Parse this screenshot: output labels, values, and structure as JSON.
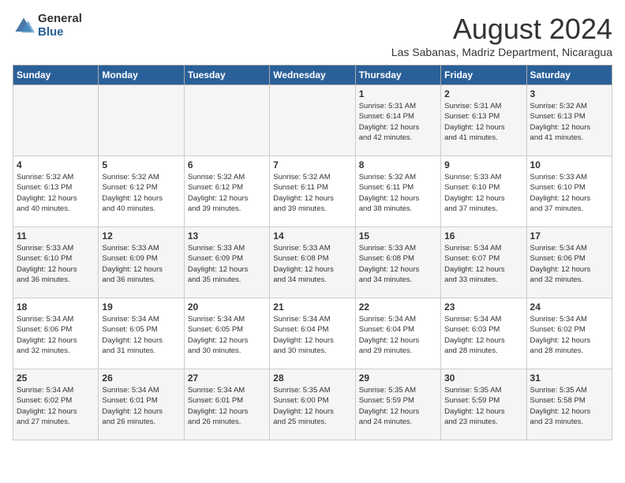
{
  "logo": {
    "general": "General",
    "blue": "Blue"
  },
  "title": {
    "month_year": "August 2024",
    "location": "Las Sabanas, Madriz Department, Nicaragua"
  },
  "days_of_week": [
    "Sunday",
    "Monday",
    "Tuesday",
    "Wednesday",
    "Thursday",
    "Friday",
    "Saturday"
  ],
  "weeks": [
    [
      {
        "day": "",
        "info": ""
      },
      {
        "day": "",
        "info": ""
      },
      {
        "day": "",
        "info": ""
      },
      {
        "day": "",
        "info": ""
      },
      {
        "day": "1",
        "info": "Sunrise: 5:31 AM\nSunset: 6:14 PM\nDaylight: 12 hours\nand 42 minutes."
      },
      {
        "day": "2",
        "info": "Sunrise: 5:31 AM\nSunset: 6:13 PM\nDaylight: 12 hours\nand 41 minutes."
      },
      {
        "day": "3",
        "info": "Sunrise: 5:32 AM\nSunset: 6:13 PM\nDaylight: 12 hours\nand 41 minutes."
      }
    ],
    [
      {
        "day": "4",
        "info": "Sunrise: 5:32 AM\nSunset: 6:13 PM\nDaylight: 12 hours\nand 40 minutes."
      },
      {
        "day": "5",
        "info": "Sunrise: 5:32 AM\nSunset: 6:12 PM\nDaylight: 12 hours\nand 40 minutes."
      },
      {
        "day": "6",
        "info": "Sunrise: 5:32 AM\nSunset: 6:12 PM\nDaylight: 12 hours\nand 39 minutes."
      },
      {
        "day": "7",
        "info": "Sunrise: 5:32 AM\nSunset: 6:11 PM\nDaylight: 12 hours\nand 39 minutes."
      },
      {
        "day": "8",
        "info": "Sunrise: 5:32 AM\nSunset: 6:11 PM\nDaylight: 12 hours\nand 38 minutes."
      },
      {
        "day": "9",
        "info": "Sunrise: 5:33 AM\nSunset: 6:10 PM\nDaylight: 12 hours\nand 37 minutes."
      },
      {
        "day": "10",
        "info": "Sunrise: 5:33 AM\nSunset: 6:10 PM\nDaylight: 12 hours\nand 37 minutes."
      }
    ],
    [
      {
        "day": "11",
        "info": "Sunrise: 5:33 AM\nSunset: 6:10 PM\nDaylight: 12 hours\nand 36 minutes."
      },
      {
        "day": "12",
        "info": "Sunrise: 5:33 AM\nSunset: 6:09 PM\nDaylight: 12 hours\nand 36 minutes."
      },
      {
        "day": "13",
        "info": "Sunrise: 5:33 AM\nSunset: 6:09 PM\nDaylight: 12 hours\nand 35 minutes."
      },
      {
        "day": "14",
        "info": "Sunrise: 5:33 AM\nSunset: 6:08 PM\nDaylight: 12 hours\nand 34 minutes."
      },
      {
        "day": "15",
        "info": "Sunrise: 5:33 AM\nSunset: 6:08 PM\nDaylight: 12 hours\nand 34 minutes."
      },
      {
        "day": "16",
        "info": "Sunrise: 5:34 AM\nSunset: 6:07 PM\nDaylight: 12 hours\nand 33 minutes."
      },
      {
        "day": "17",
        "info": "Sunrise: 5:34 AM\nSunset: 6:06 PM\nDaylight: 12 hours\nand 32 minutes."
      }
    ],
    [
      {
        "day": "18",
        "info": "Sunrise: 5:34 AM\nSunset: 6:06 PM\nDaylight: 12 hours\nand 32 minutes."
      },
      {
        "day": "19",
        "info": "Sunrise: 5:34 AM\nSunset: 6:05 PM\nDaylight: 12 hours\nand 31 minutes."
      },
      {
        "day": "20",
        "info": "Sunrise: 5:34 AM\nSunset: 6:05 PM\nDaylight: 12 hours\nand 30 minutes."
      },
      {
        "day": "21",
        "info": "Sunrise: 5:34 AM\nSunset: 6:04 PM\nDaylight: 12 hours\nand 30 minutes."
      },
      {
        "day": "22",
        "info": "Sunrise: 5:34 AM\nSunset: 6:04 PM\nDaylight: 12 hours\nand 29 minutes."
      },
      {
        "day": "23",
        "info": "Sunrise: 5:34 AM\nSunset: 6:03 PM\nDaylight: 12 hours\nand 28 minutes."
      },
      {
        "day": "24",
        "info": "Sunrise: 5:34 AM\nSunset: 6:02 PM\nDaylight: 12 hours\nand 28 minutes."
      }
    ],
    [
      {
        "day": "25",
        "info": "Sunrise: 5:34 AM\nSunset: 6:02 PM\nDaylight: 12 hours\nand 27 minutes."
      },
      {
        "day": "26",
        "info": "Sunrise: 5:34 AM\nSunset: 6:01 PM\nDaylight: 12 hours\nand 26 minutes."
      },
      {
        "day": "27",
        "info": "Sunrise: 5:34 AM\nSunset: 6:01 PM\nDaylight: 12 hours\nand 26 minutes."
      },
      {
        "day": "28",
        "info": "Sunrise: 5:35 AM\nSunset: 6:00 PM\nDaylight: 12 hours\nand 25 minutes."
      },
      {
        "day": "29",
        "info": "Sunrise: 5:35 AM\nSunset: 5:59 PM\nDaylight: 12 hours\nand 24 minutes."
      },
      {
        "day": "30",
        "info": "Sunrise: 5:35 AM\nSunset: 5:59 PM\nDaylight: 12 hours\nand 23 minutes."
      },
      {
        "day": "31",
        "info": "Sunrise: 5:35 AM\nSunset: 5:58 PM\nDaylight: 12 hours\nand 23 minutes."
      }
    ]
  ]
}
